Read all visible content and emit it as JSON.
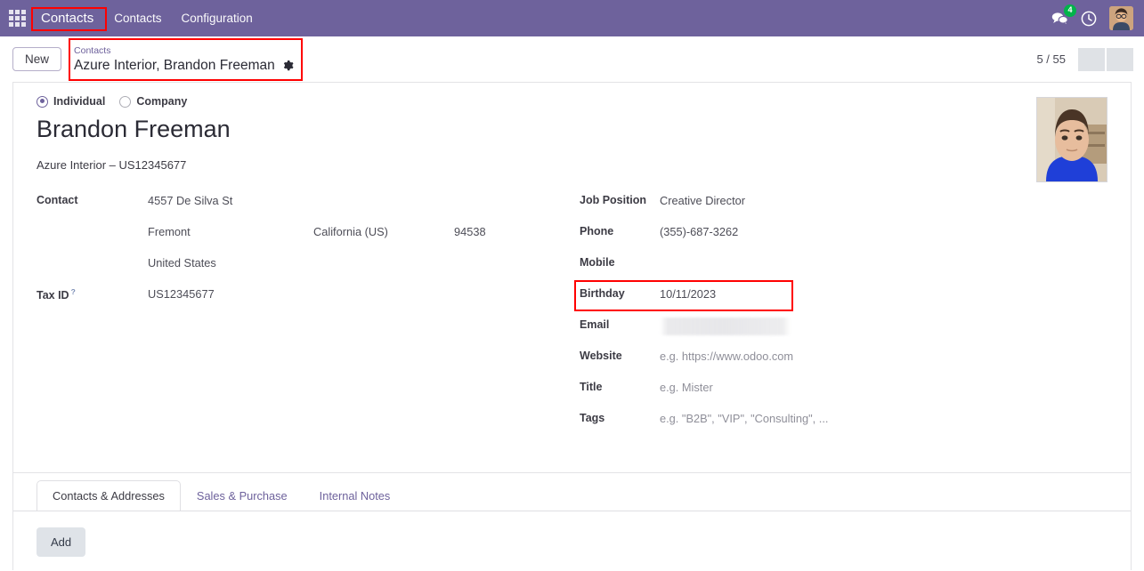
{
  "navbar": {
    "apps_icon": "apps-grid-icon",
    "brand": "Contacts",
    "menu_items": [
      "Contacts",
      "Configuration"
    ],
    "messages_icon": "messages-icon",
    "messages_count": "4",
    "activities_icon": "clock-icon",
    "avatar_icon": "user-avatar",
    "bg_color": "#6E629C",
    "badge_color": "#00b34a"
  },
  "control_panel": {
    "new_button": "New",
    "breadcrumb_parent": "Contacts",
    "breadcrumb_current": "Azure Interior, Brandon Freeman",
    "settings_icon": "gear-icon",
    "pager": "5 / 55",
    "pager_prev_icon": "chevron-left-icon",
    "pager_next_icon": "chevron-right-icon",
    "highlight_color": "#ff0000"
  },
  "record": {
    "type_options": [
      {
        "label": "Individual",
        "selected": true
      },
      {
        "label": "Company",
        "selected": false
      }
    ],
    "name": "Brandon Freeman",
    "company_line": "Azure Interior – US12345677",
    "avatar": "contact-photo"
  },
  "left_fields": {
    "contact_label": "Contact",
    "street": "4557 De Silva St",
    "city": "Fremont",
    "state": "California (US)",
    "zip": "94538",
    "country": "United States",
    "tax_id_label": "Tax ID",
    "tax_id_help": "?",
    "tax_id_value": "US12345677"
  },
  "right_fields": [
    {
      "label": "Job Position",
      "value": "Creative Director",
      "placeholder": false
    },
    {
      "label": "Phone",
      "value": "(355)-687-3262",
      "placeholder": false
    },
    {
      "label": "Mobile",
      "value": "",
      "placeholder": false
    },
    {
      "label": "Birthday",
      "value": "10/11/2023",
      "placeholder": false,
      "highlighted": true
    },
    {
      "label": "Email",
      "value": "",
      "placeholder": false,
      "redacted": true
    },
    {
      "label": "Website",
      "value": "e.g. https://www.odoo.com",
      "placeholder": true
    },
    {
      "label": "Title",
      "value": "e.g. Mister",
      "placeholder": true
    },
    {
      "label": "Tags",
      "value": "e.g. \"B2B\", \"VIP\", \"Consulting\", ...",
      "placeholder": true
    }
  ],
  "notebook": {
    "tabs": [
      {
        "label": "Contacts & Addresses",
        "active": true
      },
      {
        "label": "Sales & Purchase",
        "active": false
      },
      {
        "label": "Internal Notes",
        "active": false
      }
    ],
    "add_button": "Add"
  }
}
